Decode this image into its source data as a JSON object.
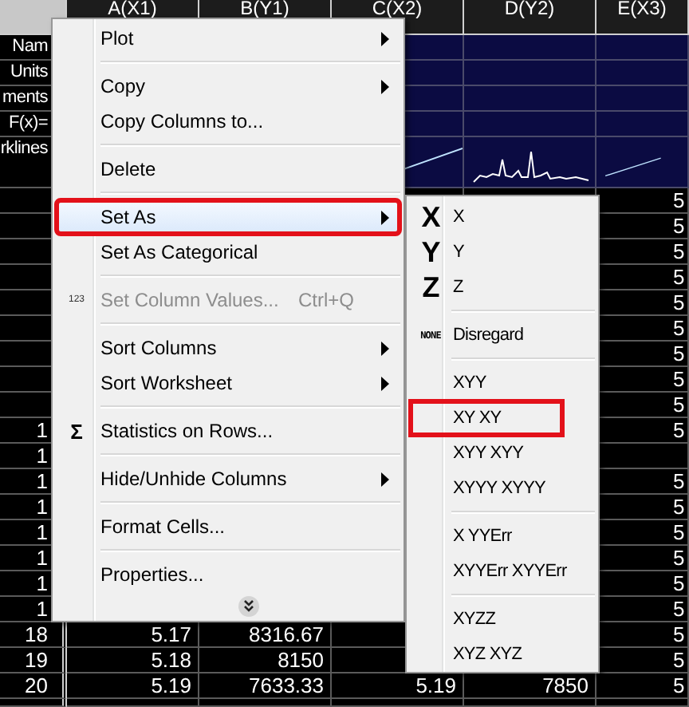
{
  "sheet": {
    "columns": [
      "A(X1)",
      "B(Y1)",
      "C(X2)",
      "D(Y2)",
      "E(X3)"
    ],
    "label_rows": [
      {
        "kind": "label",
        "label": "Nam"
      },
      {
        "kind": "label",
        "label": "Units"
      },
      {
        "kind": "label",
        "label": "ments"
      },
      {
        "kind": "label",
        "label": "F(x)="
      },
      {
        "kind": "sparklines",
        "label": "rklines"
      }
    ],
    "rows": [
      {
        "cells": {
          "E": "5"
        }
      },
      {
        "cells": {
          "E": "5"
        }
      },
      {
        "cells": {
          "E": "5"
        }
      },
      {
        "cells": {
          "E": "5"
        }
      },
      {
        "cells": {
          "E": "5"
        }
      },
      {
        "cells": {
          "E": "5"
        }
      },
      {
        "cells": {
          "E": "5"
        }
      },
      {
        "cells": {
          "E": "5"
        }
      },
      {
        "cells": {
          "E": "5"
        }
      },
      {
        "number": "1",
        "cells": {
          "E": "5"
        }
      },
      {
        "number": "1"
      },
      {
        "number": "1",
        "cells": {
          "E": "5"
        }
      },
      {
        "number": "1",
        "cells": {
          "E": "5"
        }
      },
      {
        "number": "1",
        "cells": {
          "E": "5"
        }
      },
      {
        "number": "1",
        "cells": {
          "E": "5"
        }
      },
      {
        "number": "1",
        "cells": {
          "E": "5"
        }
      },
      {
        "number": "1",
        "cells": {
          "E": "5"
        }
      },
      {
        "number": "18",
        "cells": {
          "A": "5.17",
          "B": "8316.67",
          "E": "5"
        }
      },
      {
        "number": "19",
        "cells": {
          "A": "5.18",
          "B": "8150",
          "E": "5"
        }
      },
      {
        "number": "20",
        "cells": {
          "A": "5.19",
          "B": "7633.33",
          "C": "5.19",
          "D": "7850",
          "E": "5"
        }
      }
    ]
  },
  "context_menu": {
    "items": [
      {
        "kind": "item",
        "label": "Plot",
        "submenu": true,
        "selected": false,
        "annotated": false,
        "disabled": false
      },
      {
        "kind": "separator"
      },
      {
        "kind": "item",
        "label": "Copy",
        "submenu": true,
        "selected": false,
        "annotated": false,
        "disabled": false
      },
      {
        "kind": "item",
        "label": "Copy Columns to...",
        "submenu": false,
        "selected": false,
        "annotated": false,
        "disabled": false
      },
      {
        "kind": "separator"
      },
      {
        "kind": "item",
        "label": "Delete",
        "submenu": false,
        "selected": false,
        "annotated": false,
        "disabled": false
      },
      {
        "kind": "separator"
      },
      {
        "kind": "item",
        "label": "Set As",
        "submenu": true,
        "selected": true,
        "annotated": true,
        "disabled": false
      },
      {
        "kind": "item",
        "label": "Set As Categorical",
        "submenu": false,
        "selected": false,
        "annotated": false,
        "disabled": false
      },
      {
        "kind": "separator"
      },
      {
        "kind": "values-item",
        "icon_text": "123",
        "label": "Set Column Values...",
        "shortcut": "Ctrl+Q",
        "submenu": false,
        "selected": false,
        "annotated": false,
        "disabled": true
      },
      {
        "kind": "separator"
      },
      {
        "kind": "item",
        "label": "Sort Columns",
        "submenu": true,
        "selected": false,
        "annotated": false,
        "disabled": false
      },
      {
        "kind": "item",
        "label": "Sort Worksheet",
        "submenu": true,
        "selected": false,
        "annotated": false,
        "disabled": false
      },
      {
        "kind": "separator"
      },
      {
        "kind": "stats-item",
        "icon_text": "Σ",
        "label": "Statistics on Rows...",
        "submenu": false,
        "selected": false,
        "annotated": false,
        "disabled": false
      },
      {
        "kind": "separator"
      },
      {
        "kind": "item",
        "label": "Hide/Unhide Columns",
        "submenu": true,
        "selected": false,
        "annotated": false,
        "disabled": false
      },
      {
        "kind": "separator"
      },
      {
        "kind": "item",
        "label": "Format Cells...",
        "submenu": false,
        "selected": false,
        "annotated": false,
        "disabled": false
      },
      {
        "kind": "separator"
      },
      {
        "kind": "item",
        "label": "Properties...",
        "submenu": false,
        "selected": false,
        "annotated": false,
        "disabled": false
      },
      {
        "kind": "more"
      }
    ]
  },
  "submenu": {
    "items": [
      {
        "kind": "letter-item",
        "icon_text": "X",
        "label": "X",
        "annotated": false
      },
      {
        "kind": "letter-item",
        "icon_text": "Y",
        "label": "Y",
        "annotated": false
      },
      {
        "kind": "letter-item",
        "icon_text": "Z",
        "label": "Z",
        "annotated": false
      },
      {
        "kind": "separator"
      },
      {
        "kind": "none-item",
        "icon_text": "NONE",
        "label": "Disregard",
        "annotated": false
      },
      {
        "kind": "separator"
      },
      {
        "kind": "item",
        "label": "XYY",
        "annotated": false
      },
      {
        "kind": "item",
        "label": "XY XY",
        "annotated": true
      },
      {
        "kind": "item",
        "label": "XYY XYY",
        "annotated": false
      },
      {
        "kind": "item",
        "label": "XYYY XYYY",
        "annotated": false
      },
      {
        "kind": "separator"
      },
      {
        "kind": "item",
        "label": "X YYErr",
        "annotated": false
      },
      {
        "kind": "item",
        "label": "XYYErr XYYErr",
        "annotated": false
      },
      {
        "kind": "separator"
      },
      {
        "kind": "item",
        "label": "XYZZ",
        "annotated": false
      },
      {
        "kind": "item",
        "label": "XYZ XYZ",
        "annotated": false
      }
    ]
  }
}
